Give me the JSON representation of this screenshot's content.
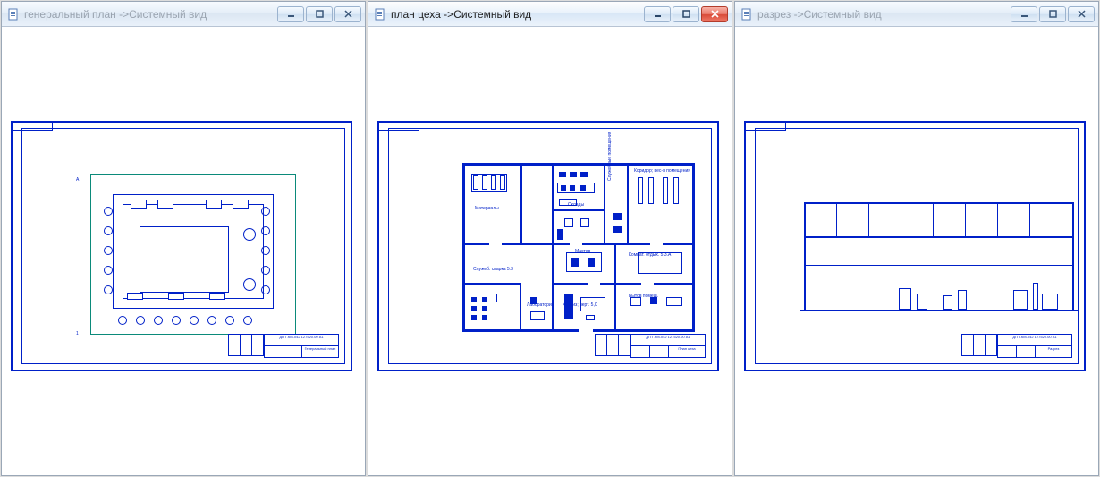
{
  "windows": [
    {
      "id": "w1",
      "title": "генеральный план ->Системный вид",
      "active": false,
      "drawing_name": "Генеральный план"
    },
    {
      "id": "w2",
      "title": "план цеха ->Системный вид",
      "active": true,
      "drawing_name": "План цеха"
    },
    {
      "id": "w3",
      "title": "разрез ->Системный вид",
      "active": false,
      "drawing_name": "Разрез"
    }
  ],
  "stamp_code": "ДП Г.КМ-042 127520.00 А1",
  "room_labels": {
    "mat": "Материалы",
    "skl": "Склады",
    "sluz": "Служебные помещения",
    "kor": "Коридор; вес-я помещения",
    "mast": "Мастер",
    "komn": "Комнат. отдых. 5.3.А",
    "sluzh_sv": "Служеб. сварка 5.3",
    "lab": "Лаборатория",
    "karn": "Карниз; черт. 5,0",
    "bytov": "Бытов помещ."
  },
  "buttons": {
    "minimize": "Свернуть",
    "maximize": "Развернуть",
    "close": "Закрыть"
  }
}
